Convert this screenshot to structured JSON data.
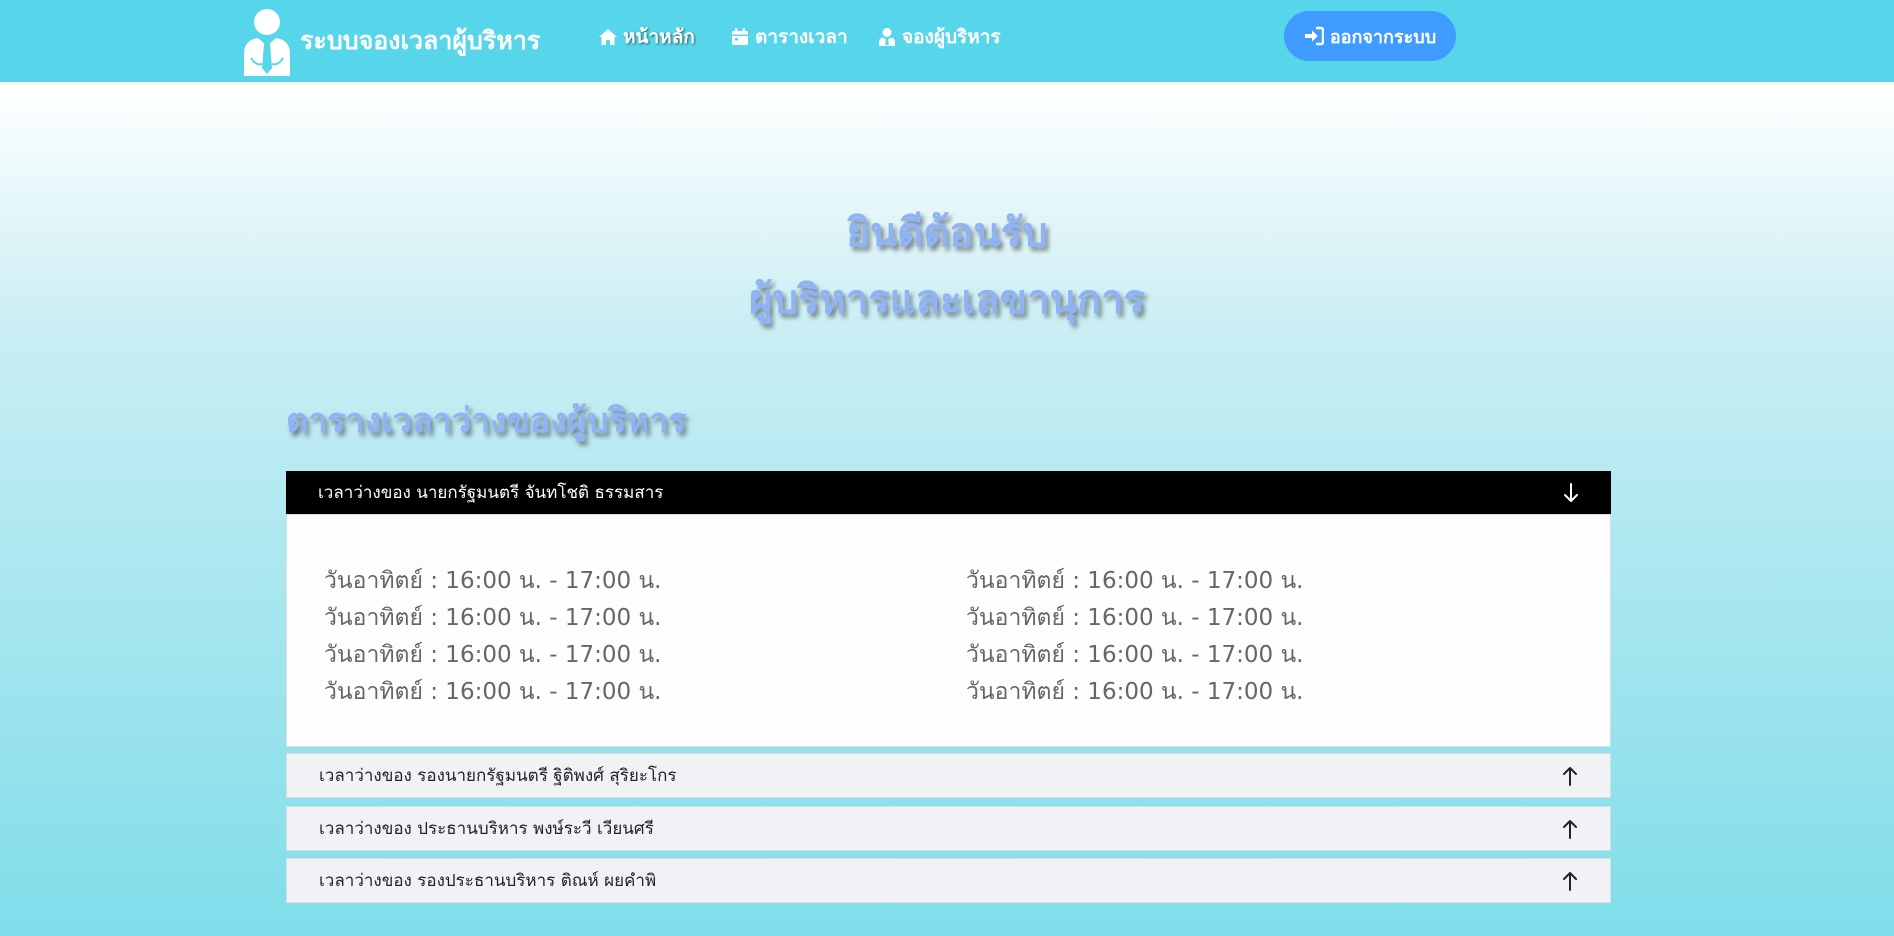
{
  "navbar": {
    "brand": "ระบบจองเวลาผู้บริหาร",
    "logo_icon": "businessman-icon",
    "items": [
      {
        "label": "หน้าหลัก",
        "icon": "home-icon"
      },
      {
        "label": "ตารางเวลา",
        "icon": "calendar-icon"
      },
      {
        "label": "จองผู้บริหาร",
        "icon": "user-tie-icon"
      }
    ],
    "logout": {
      "label": "ออกจากระบบ",
      "icon": "sign-in-icon"
    }
  },
  "hero": {
    "line1": "ยินดีต้อนรับ",
    "line2": "ผู้บริหารและเลขานุการ"
  },
  "section_title": "ตารางเวลาว่างของผู้บริหาร",
  "accordion": [
    {
      "title": "เวลาว่างของ นายกรัฐมนตรี จันทโชติ ธรรมสาร",
      "expanded": true,
      "slots": [
        "วันอาทิตย์ : 16:00 น. - 17:00 น.",
        "วันอาทิตย์ : 16:00 น. - 17:00 น.",
        "วันอาทิตย์ : 16:00 น. - 17:00 น.",
        "วันอาทิตย์ : 16:00 น. - 17:00 น.",
        "วันอาทิตย์ : 16:00 น. - 17:00 น.",
        "วันอาทิตย์ : 16:00 น. - 17:00 น.",
        "วันอาทิตย์ : 16:00 น. - 17:00 น.",
        "วันอาทิตย์ : 16:00 น. - 17:00 น."
      ]
    },
    {
      "title": "เวลาว่างของ รองนายกรัฐมนตรี ฐิติพงศ์ สุริยะโกร",
      "expanded": false
    },
    {
      "title": "เวลาว่างของ ประธานบริหาร พงษ์ระวี เวียนศรี",
      "expanded": false
    },
    {
      "title": "เวลาว่างของ รองประธานบริหาร ติณห์ ผยคำพิ",
      "expanded": false
    }
  ],
  "colors": {
    "navbar_bg": "#57d5ea",
    "logout_bg": "#3f9bff",
    "title_color": "#8fb3f5",
    "active_header_bg": "#000000"
  }
}
